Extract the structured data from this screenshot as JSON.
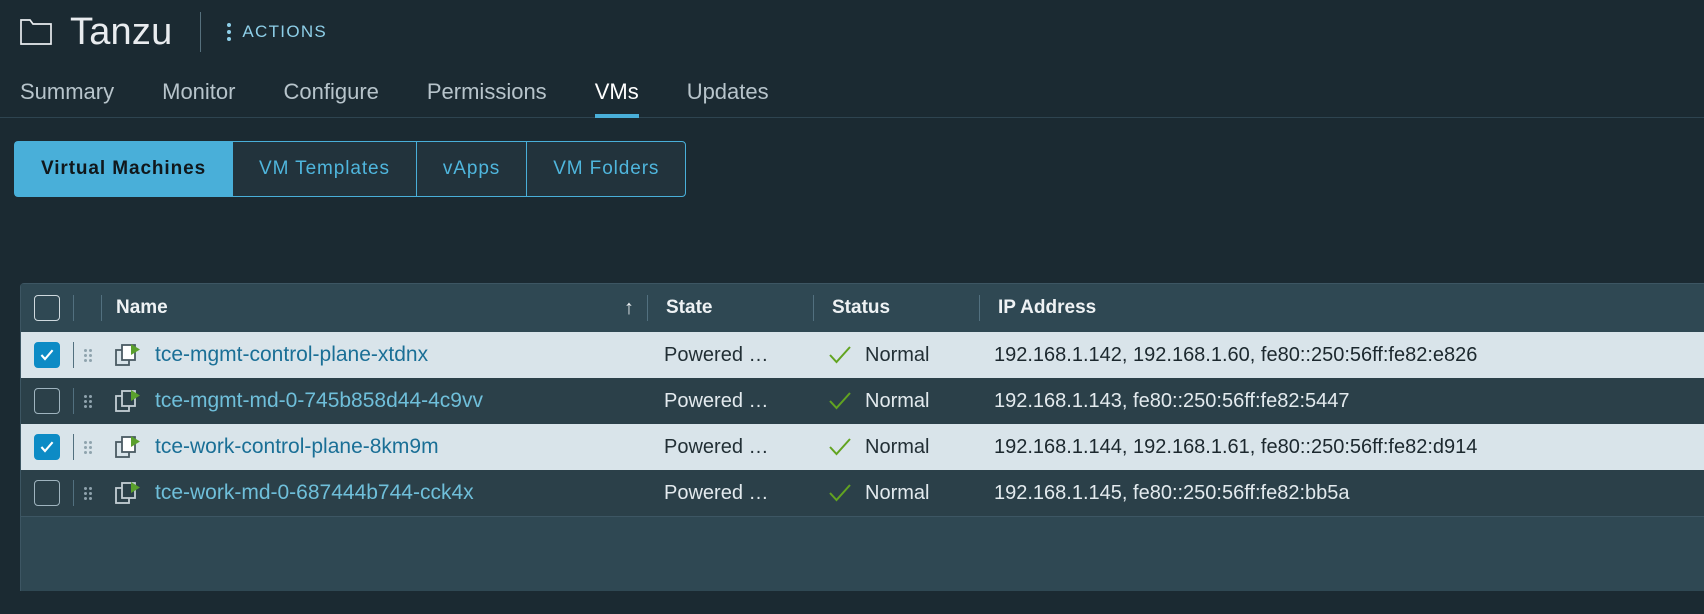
{
  "header": {
    "folder_icon": "folder-icon",
    "object_title": "Tanzu",
    "actions_label": "ACTIONS",
    "kebab_icon": "kebab-menu-icon"
  },
  "primary_tabs": [
    {
      "label": "Summary",
      "active": false
    },
    {
      "label": "Monitor",
      "active": false
    },
    {
      "label": "Configure",
      "active": false
    },
    {
      "label": "Permissions",
      "active": false
    },
    {
      "label": "VMs",
      "active": true
    },
    {
      "label": "Updates",
      "active": false
    }
  ],
  "secondary_tabs": [
    {
      "label": "Virtual Machines",
      "active": true
    },
    {
      "label": "VM Templates",
      "active": false
    },
    {
      "label": "vApps",
      "active": false
    },
    {
      "label": "VM Folders",
      "active": false
    }
  ],
  "table": {
    "select_all_checked": false,
    "columns": [
      {
        "key": "name",
        "label": "Name",
        "sorted": true,
        "sort_icon": "sort-ascending-arrow"
      },
      {
        "key": "state",
        "label": "State",
        "sorted": false
      },
      {
        "key": "status",
        "label": "Status",
        "sorted": false
      },
      {
        "key": "ip",
        "label": "IP Address",
        "sorted": false
      }
    ],
    "rows": [
      {
        "selected": true,
        "vm_icon": "virtual-machine-powered-on-icon",
        "drag_handle_icon": "drag-handle-icon",
        "name": "tce-mgmt-control-plane-xtdnx",
        "state": "Powered …",
        "status_icon": "check-success-icon",
        "status": "Normal",
        "ip": "192.168.1.142, 192.168.1.60, fe80::250:56ff:fe82:e826"
      },
      {
        "selected": false,
        "vm_icon": "virtual-machine-powered-on-icon",
        "drag_handle_icon": "drag-handle-icon",
        "name": "tce-mgmt-md-0-745b858d44-4c9vv",
        "state": "Powered …",
        "status_icon": "check-success-icon",
        "status": "Normal",
        "ip": "192.168.1.143, fe80::250:56ff:fe82:5447"
      },
      {
        "selected": true,
        "vm_icon": "virtual-machine-powered-on-icon",
        "drag_handle_icon": "drag-handle-icon",
        "name": "tce-work-control-plane-8km9m",
        "state": "Powered …",
        "status_icon": "check-success-icon",
        "status": "Normal",
        "ip": "192.168.1.144, 192.168.1.61, fe80::250:56ff:fe82:d914"
      },
      {
        "selected": false,
        "vm_icon": "virtual-machine-powered-on-icon",
        "drag_handle_icon": "drag-handle-icon",
        "name": "tce-work-md-0-687444b744-cck4x",
        "state": "Powered …",
        "status_icon": "check-success-icon",
        "status": "Normal",
        "ip": "192.168.1.145, fe80::250:56ff:fe82:bb5a"
      }
    ]
  },
  "colors": {
    "page_background": "#1b2a32",
    "accent_blue": "#49afd9",
    "link_blue": "#6fbfda",
    "selected_row": "#d9e4ea",
    "header_row": "#2f4853",
    "row_alt": "#2b4049",
    "status_green": "#62a420"
  }
}
